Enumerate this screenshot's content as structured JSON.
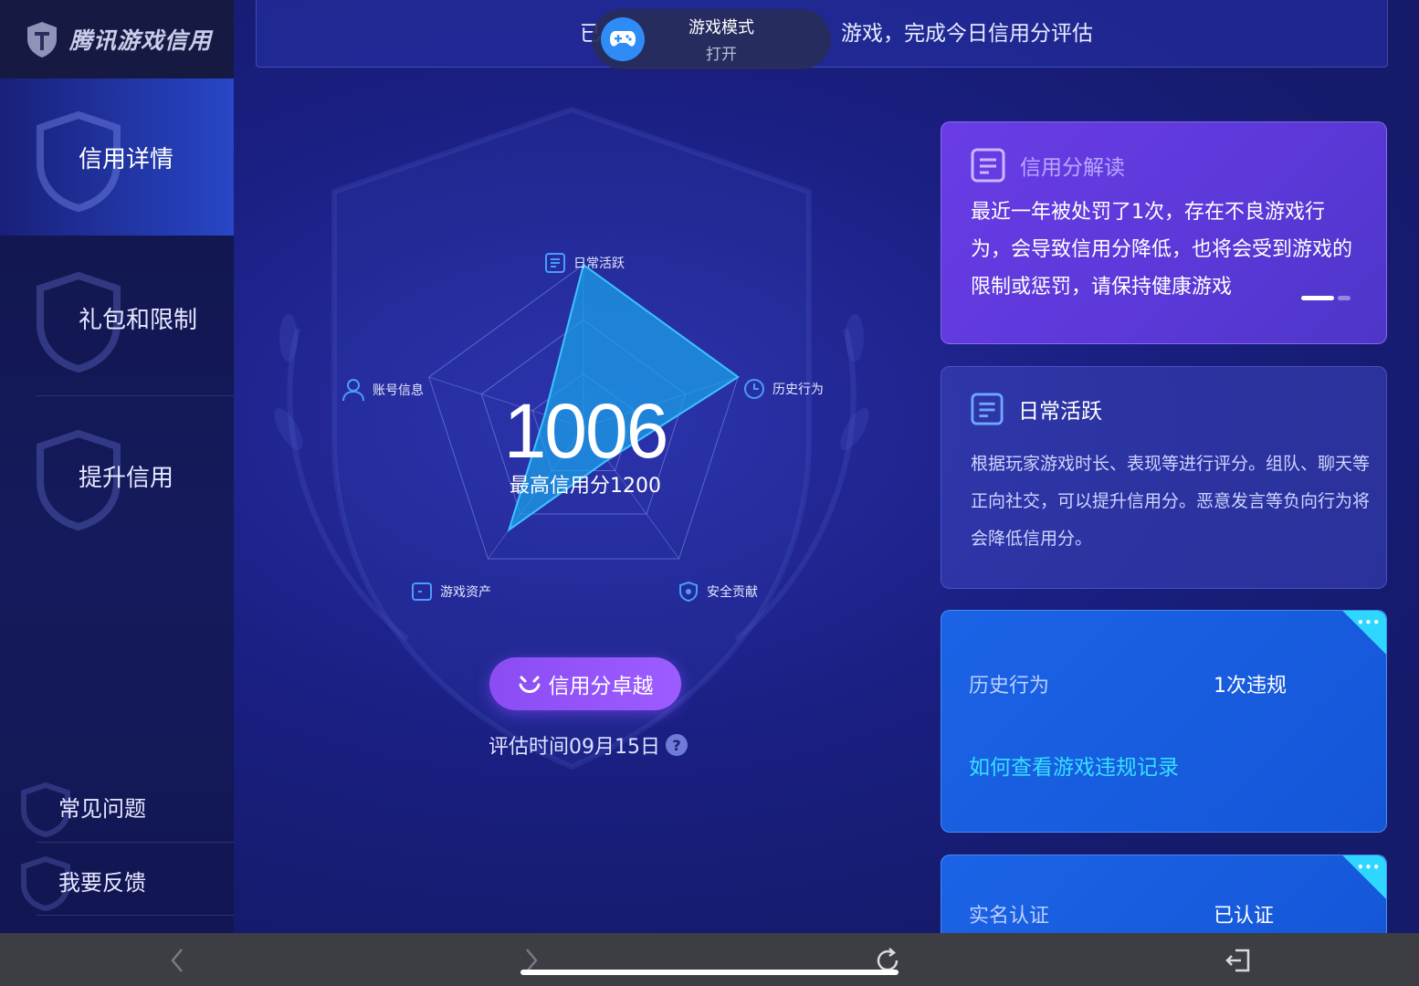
{
  "app": {
    "logo_text": "腾讯游戏信用"
  },
  "sidebar": {
    "items": [
      {
        "label": "信用详情",
        "active": true
      },
      {
        "label": "礼包和限制"
      },
      {
        "label": "提升信用"
      }
    ],
    "bottom_items": [
      {
        "label": "常见问题"
      },
      {
        "label": "我要反馈"
      }
    ]
  },
  "banner": {
    "text_left": "已",
    "text_right": "游戏，完成今日信用分评估"
  },
  "toast": {
    "title": "游戏模式",
    "subtitle": "打开",
    "icon": "gamepad-icon"
  },
  "credit": {
    "score": "1006",
    "max_text": "最高信用分1200",
    "rank_button": "信用分卓越",
    "eval_time": "评估时间09月15日",
    "help": "?"
  },
  "radar": {
    "axes": [
      {
        "label": "日常活跃",
        "icon": "document-icon",
        "value": 1.0
      },
      {
        "label": "历史行为",
        "icon": "clock-icon",
        "value": 1.0
      },
      {
        "label": "安全贡献",
        "icon": "shield-icon",
        "value": 0.25
      },
      {
        "label": "游戏资产",
        "icon": "wallet-icon",
        "value": 0.78
      },
      {
        "label": "账号信息",
        "icon": "user-icon",
        "value": 0.25
      }
    ]
  },
  "cards": {
    "interpretation": {
      "title": "信用分解读",
      "body": "最近一年被处罚了1次，存在不良游戏行为，会导致信用分降低，也将会受到游戏的限制或惩罚，请保持健康游戏"
    },
    "daily": {
      "title": "日常活跃",
      "body": "根据玩家游戏时长、表现等进行评分。组队、聊天等正向社交，可以提升信用分。恶意发言等负向行为将会降低信用分。"
    },
    "history": {
      "label": "历史行为",
      "value": "1次违规",
      "link": "如何查看游戏违规记录",
      "tag": "•••"
    },
    "realname": {
      "label": "实名认证",
      "value": "已认证",
      "tag": "•••"
    }
  },
  "bottombar": {
    "back_icon": "chevron-left-icon",
    "forward_icon": "chevron-right-icon",
    "refresh_icon": "refresh-icon",
    "exit_icon": "exit-icon"
  },
  "colors": {
    "accent_purple": "#9d5cff",
    "accent_cyan": "#35e0ff",
    "radar_fill": "#1aa3ea"
  }
}
